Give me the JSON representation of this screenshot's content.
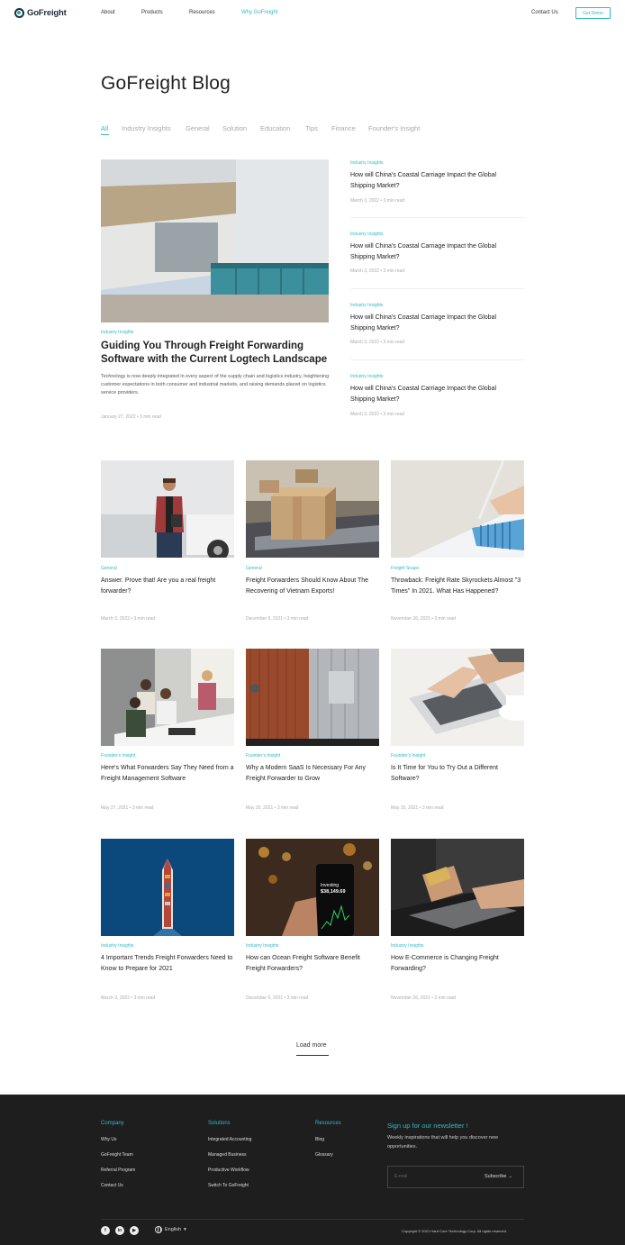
{
  "header": {
    "logo": "GoFreight",
    "nav": [
      "About",
      "Products",
      "Resources",
      "Why GoFreight"
    ],
    "contact": "Contact Us",
    "cta": "Get Demo"
  },
  "page": {
    "title": "GoFreight Blog",
    "tabs": [
      "All",
      "Industry Insights",
      "General",
      "Solution",
      "Education",
      "Tips",
      "Finance",
      "Founder's Insight"
    ]
  },
  "featured": {
    "category": "Industry Insights",
    "title": "Guiding You Through Freight Forwarding Software with the Current Logtech Landscape",
    "description": "Technology is now deeply integrated in every aspect of the supply chain and logistics industry, heightening customer expectations in both consumer and industrial markets, and raising demands placed on logistics service providers.",
    "meta": "January 27, 2022 • 3 min read"
  },
  "side_posts": [
    {
      "category": "Industry Insights",
      "title": "How will China's Coastal Carriage Impact the Global Shipping Market?",
      "meta": "March 3, 2022 • 3 min read"
    },
    {
      "category": "Industry Insights",
      "title": "How will China's Coastal Carriage Impact the Global Shipping Market?",
      "meta": "March 3, 2022 • 3 min read"
    },
    {
      "category": "Industry Insights",
      "title": "How will China's Coastal Carriage Impact the Global Shipping Market?",
      "meta": "March 3, 2022 • 3 min read"
    },
    {
      "category": "Industry Insights",
      "title": "How will China's Coastal Carriage Impact the Global Shipping Market?",
      "meta": "March 3, 2022 • 3 min read"
    }
  ],
  "posts": [
    {
      "category": "General",
      "title": "Answer. Prove that! Are you a real freight forwarder?",
      "meta": "March 3, 2022 • 3 min read"
    },
    {
      "category": "General",
      "title": "Freight Forwarders Should Know About The Recovering of Vietnam Exports!",
      "meta": "December 6, 2021 • 3 min read"
    },
    {
      "category": "Freight Snaps",
      "title": "Throwback: Freight Rate Skyrockets Almost \"3 Times\" In 2021. What Has Happened?",
      "meta": "November 26, 2021 • 3 min read"
    },
    {
      "category": "Founder's Insight",
      "title": "Here's What Forwarders Say They Need from a Freight Management Software",
      "meta": "May 27, 2021 • 3 min read"
    },
    {
      "category": "Founder's Insight",
      "title": "Why a Modern SaaS Is Necessary For Any Freight Forwarder to Grow",
      "meta": "May 20, 2021 • 3 min read"
    },
    {
      "category": "Founder's Insight",
      "title": "Is It Time for You to Try Out a Different Software?",
      "meta": "May 10, 2021 • 3 min read"
    },
    {
      "category": "Industry Insights",
      "title": "4 Important Trends Freight Forwarders Need to Know to Prepare for 2021",
      "meta": "March 3, 2022 • 3 min read"
    },
    {
      "category": "Industry Insights",
      "title": "How can Ocean Freight Software Benefit Freight Forwarders?",
      "meta": "December 6, 2021 • 3 min read"
    },
    {
      "category": "Industry Insights",
      "title": "How E-Commerce is Changing Freight Forwarding?",
      "meta": "November 26, 2021 • 3 min read"
    }
  ],
  "phone_screen": {
    "label": "Investing",
    "value": "$38,149.69"
  },
  "load_more": "Load more",
  "footer": {
    "columns": [
      {
        "heading": "Company",
        "links": [
          "Why Us",
          "GoFreight Team",
          "Referral Program",
          "Contact Us"
        ]
      },
      {
        "heading": "Solutions",
        "links": [
          "Integrated Accounting",
          "Managed Business",
          "Productive Workflow",
          "Switch To GoFreight"
        ]
      },
      {
        "heading": "Resources",
        "links": [
          "Blog",
          "Glossary"
        ]
      }
    ],
    "newsletter_title": "Sign up for our newsletter !",
    "newsletter_desc": "Weekly inspirations that will help you discover new opportunities.",
    "email_placeholder": "E-mail",
    "subscribe": "Subscribe →",
    "social": [
      "facebook-icon",
      "linkedin-icon",
      "youtube-icon"
    ],
    "language": "English",
    "copyright": "Copyright © 2021 Hard Core Technology Corp. All rights reserved."
  },
  "colors": {
    "accent": "#36b8c6",
    "footer_bg": "#1e1e1e",
    "text": "#222222"
  }
}
